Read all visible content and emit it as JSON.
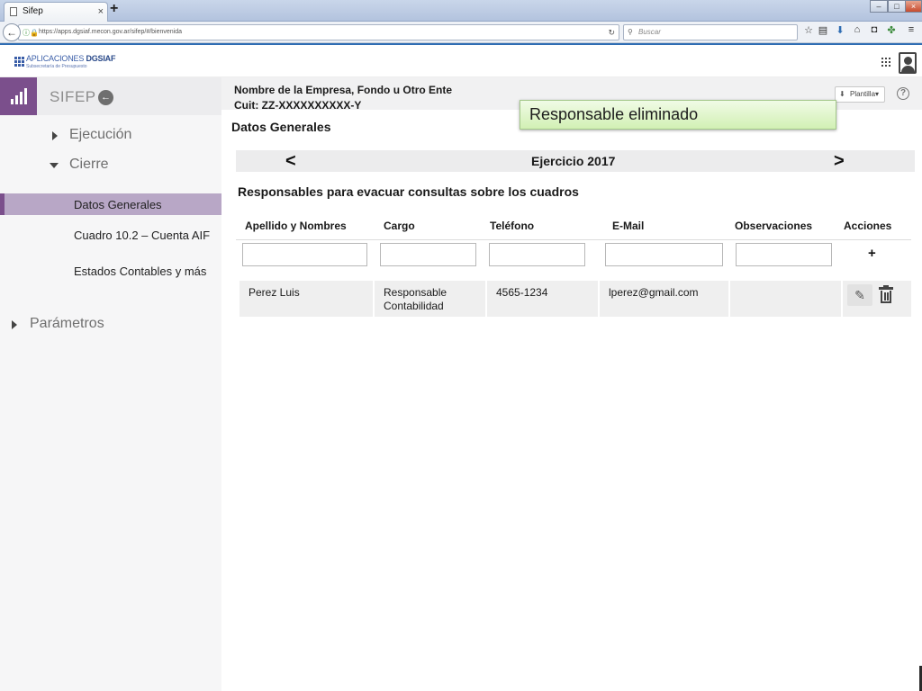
{
  "browser": {
    "tab_title": "Sifep",
    "tab_close": "×",
    "new_tab": "+",
    "url": "https://apps.dgsiaf.mecon.gov.ar/sifep/#/bienvenida",
    "search_placeholder": "Buscar"
  },
  "header": {
    "logo_prefix": "APLICACIONES",
    "logo_brand": "DGSIAF",
    "logo_subtitle": "Subsecretaría de Presupuesto"
  },
  "sidebar": {
    "title": "SIFEP",
    "sections": {
      "ejecucion": "Ejecución",
      "cierre": "Cierre",
      "parametros": "Parámetros"
    },
    "items": [
      {
        "label": "Datos Generales",
        "active": true
      },
      {
        "label": "Cuadro 10.2  – Cuenta AIF",
        "active": false
      },
      {
        "label": "Estados Contables y más",
        "active": false
      }
    ]
  },
  "entity": {
    "name": "Nombre de la Empresa, Fondo u Otro Ente",
    "cuit": "Cuit: ZZ-XXXXXXXXXX-Y"
  },
  "toolbar": {
    "plantilla_label": "Plantilla",
    "help_label": "?"
  },
  "toast": {
    "message": "Responsable eliminado"
  },
  "page": {
    "title": "Datos Generales",
    "year_label": "Ejercicio 2017",
    "prev": "<",
    "next": ">",
    "subtitle": "Responsables para evacuar consultas sobre los cuadros"
  },
  "table": {
    "headers": [
      "Apellido y Nombres",
      "Cargo",
      "Teléfono",
      "E-Mail",
      "Observaciones",
      "Acciones"
    ],
    "add_label": "+",
    "rows": [
      {
        "nombre": "Perez Luis",
        "cargo": "Responsable Contabilidad",
        "telefono": "4565-1234",
        "email": "lperez@gmail.com",
        "observaciones": ""
      }
    ]
  },
  "colors": {
    "accent": "#7b4f8c",
    "active_item": "#b8a7c6",
    "toast_bg": "#d2f0b4",
    "link_blue": "#2f6db3"
  }
}
